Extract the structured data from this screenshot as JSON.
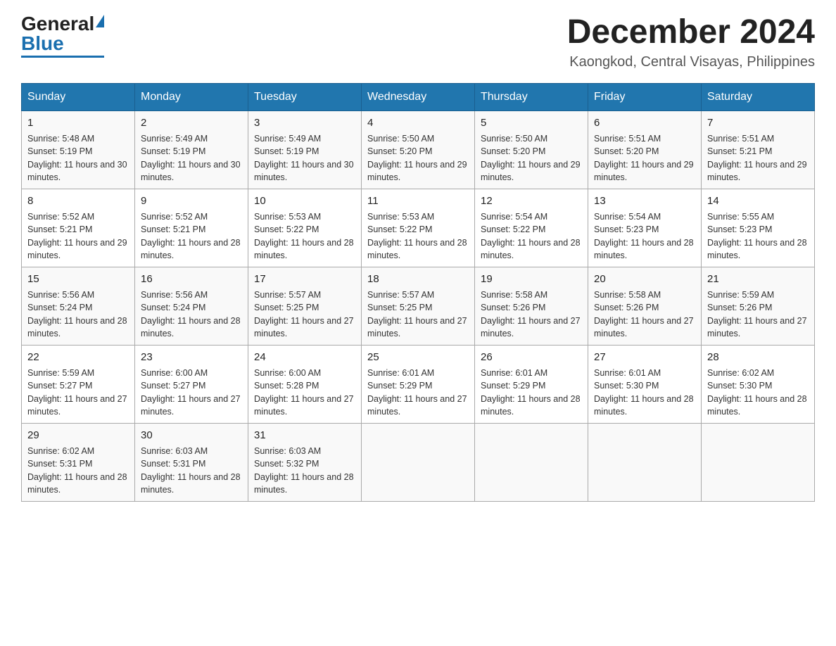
{
  "logo": {
    "general": "General",
    "blue": "Blue"
  },
  "header": {
    "month_year": "December 2024",
    "location": "Kaongkod, Central Visayas, Philippines"
  },
  "days_of_week": [
    "Sunday",
    "Monday",
    "Tuesday",
    "Wednesday",
    "Thursday",
    "Friday",
    "Saturday"
  ],
  "weeks": [
    [
      {
        "day": "1",
        "sunrise": "5:48 AM",
        "sunset": "5:19 PM",
        "daylight": "11 hours and 30 minutes."
      },
      {
        "day": "2",
        "sunrise": "5:49 AM",
        "sunset": "5:19 PM",
        "daylight": "11 hours and 30 minutes."
      },
      {
        "day": "3",
        "sunrise": "5:49 AM",
        "sunset": "5:19 PM",
        "daylight": "11 hours and 30 minutes."
      },
      {
        "day": "4",
        "sunrise": "5:50 AM",
        "sunset": "5:20 PM",
        "daylight": "11 hours and 29 minutes."
      },
      {
        "day": "5",
        "sunrise": "5:50 AM",
        "sunset": "5:20 PM",
        "daylight": "11 hours and 29 minutes."
      },
      {
        "day": "6",
        "sunrise": "5:51 AM",
        "sunset": "5:20 PM",
        "daylight": "11 hours and 29 minutes."
      },
      {
        "day": "7",
        "sunrise": "5:51 AM",
        "sunset": "5:21 PM",
        "daylight": "11 hours and 29 minutes."
      }
    ],
    [
      {
        "day": "8",
        "sunrise": "5:52 AM",
        "sunset": "5:21 PM",
        "daylight": "11 hours and 29 minutes."
      },
      {
        "day": "9",
        "sunrise": "5:52 AM",
        "sunset": "5:21 PM",
        "daylight": "11 hours and 28 minutes."
      },
      {
        "day": "10",
        "sunrise": "5:53 AM",
        "sunset": "5:22 PM",
        "daylight": "11 hours and 28 minutes."
      },
      {
        "day": "11",
        "sunrise": "5:53 AM",
        "sunset": "5:22 PM",
        "daylight": "11 hours and 28 minutes."
      },
      {
        "day": "12",
        "sunrise": "5:54 AM",
        "sunset": "5:22 PM",
        "daylight": "11 hours and 28 minutes."
      },
      {
        "day": "13",
        "sunrise": "5:54 AM",
        "sunset": "5:23 PM",
        "daylight": "11 hours and 28 minutes."
      },
      {
        "day": "14",
        "sunrise": "5:55 AM",
        "sunset": "5:23 PM",
        "daylight": "11 hours and 28 minutes."
      }
    ],
    [
      {
        "day": "15",
        "sunrise": "5:56 AM",
        "sunset": "5:24 PM",
        "daylight": "11 hours and 28 minutes."
      },
      {
        "day": "16",
        "sunrise": "5:56 AM",
        "sunset": "5:24 PM",
        "daylight": "11 hours and 28 minutes."
      },
      {
        "day": "17",
        "sunrise": "5:57 AM",
        "sunset": "5:25 PM",
        "daylight": "11 hours and 27 minutes."
      },
      {
        "day": "18",
        "sunrise": "5:57 AM",
        "sunset": "5:25 PM",
        "daylight": "11 hours and 27 minutes."
      },
      {
        "day": "19",
        "sunrise": "5:58 AM",
        "sunset": "5:26 PM",
        "daylight": "11 hours and 27 minutes."
      },
      {
        "day": "20",
        "sunrise": "5:58 AM",
        "sunset": "5:26 PM",
        "daylight": "11 hours and 27 minutes."
      },
      {
        "day": "21",
        "sunrise": "5:59 AM",
        "sunset": "5:26 PM",
        "daylight": "11 hours and 27 minutes."
      }
    ],
    [
      {
        "day": "22",
        "sunrise": "5:59 AM",
        "sunset": "5:27 PM",
        "daylight": "11 hours and 27 minutes."
      },
      {
        "day": "23",
        "sunrise": "6:00 AM",
        "sunset": "5:27 PM",
        "daylight": "11 hours and 27 minutes."
      },
      {
        "day": "24",
        "sunrise": "6:00 AM",
        "sunset": "5:28 PM",
        "daylight": "11 hours and 27 minutes."
      },
      {
        "day": "25",
        "sunrise": "6:01 AM",
        "sunset": "5:29 PM",
        "daylight": "11 hours and 27 minutes."
      },
      {
        "day": "26",
        "sunrise": "6:01 AM",
        "sunset": "5:29 PM",
        "daylight": "11 hours and 28 minutes."
      },
      {
        "day": "27",
        "sunrise": "6:01 AM",
        "sunset": "5:30 PM",
        "daylight": "11 hours and 28 minutes."
      },
      {
        "day": "28",
        "sunrise": "6:02 AM",
        "sunset": "5:30 PM",
        "daylight": "11 hours and 28 minutes."
      }
    ],
    [
      {
        "day": "29",
        "sunrise": "6:02 AM",
        "sunset": "5:31 PM",
        "daylight": "11 hours and 28 minutes."
      },
      {
        "day": "30",
        "sunrise": "6:03 AM",
        "sunset": "5:31 PM",
        "daylight": "11 hours and 28 minutes."
      },
      {
        "day": "31",
        "sunrise": "6:03 AM",
        "sunset": "5:32 PM",
        "daylight": "11 hours and 28 minutes."
      },
      null,
      null,
      null,
      null
    ]
  ]
}
